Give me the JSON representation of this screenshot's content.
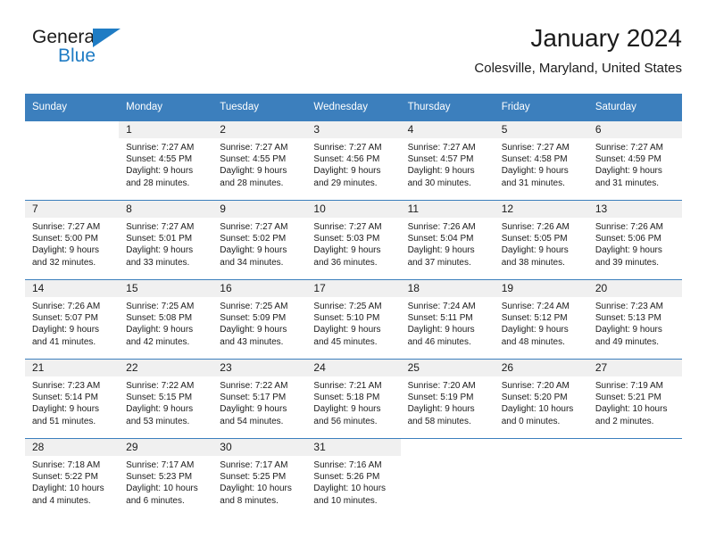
{
  "brand": {
    "name_part1": "General",
    "name_part2": "Blue",
    "accent_color": "#1f7cc4"
  },
  "header": {
    "title": "January 2024",
    "subtitle": "Colesville, Maryland, United States"
  },
  "calendar": {
    "header_bg": "#3c7fbd",
    "daynum_bg": "#f0f0f0",
    "weekday_headers": [
      "Sunday",
      "Monday",
      "Tuesday",
      "Wednesday",
      "Thursday",
      "Friday",
      "Saturday"
    ],
    "weeks": [
      [
        {
          "day": "",
          "sunrise": "",
          "sunset": "",
          "daylight1": "",
          "daylight2": ""
        },
        {
          "day": "1",
          "sunrise": "Sunrise: 7:27 AM",
          "sunset": "Sunset: 4:55 PM",
          "daylight1": "Daylight: 9 hours",
          "daylight2": "and 28 minutes."
        },
        {
          "day": "2",
          "sunrise": "Sunrise: 7:27 AM",
          "sunset": "Sunset: 4:55 PM",
          "daylight1": "Daylight: 9 hours",
          "daylight2": "and 28 minutes."
        },
        {
          "day": "3",
          "sunrise": "Sunrise: 7:27 AM",
          "sunset": "Sunset: 4:56 PM",
          "daylight1": "Daylight: 9 hours",
          "daylight2": "and 29 minutes."
        },
        {
          "day": "4",
          "sunrise": "Sunrise: 7:27 AM",
          "sunset": "Sunset: 4:57 PM",
          "daylight1": "Daylight: 9 hours",
          "daylight2": "and 30 minutes."
        },
        {
          "day": "5",
          "sunrise": "Sunrise: 7:27 AM",
          "sunset": "Sunset: 4:58 PM",
          "daylight1": "Daylight: 9 hours",
          "daylight2": "and 31 minutes."
        },
        {
          "day": "6",
          "sunrise": "Sunrise: 7:27 AM",
          "sunset": "Sunset: 4:59 PM",
          "daylight1": "Daylight: 9 hours",
          "daylight2": "and 31 minutes."
        }
      ],
      [
        {
          "day": "7",
          "sunrise": "Sunrise: 7:27 AM",
          "sunset": "Sunset: 5:00 PM",
          "daylight1": "Daylight: 9 hours",
          "daylight2": "and 32 minutes."
        },
        {
          "day": "8",
          "sunrise": "Sunrise: 7:27 AM",
          "sunset": "Sunset: 5:01 PM",
          "daylight1": "Daylight: 9 hours",
          "daylight2": "and 33 minutes."
        },
        {
          "day": "9",
          "sunrise": "Sunrise: 7:27 AM",
          "sunset": "Sunset: 5:02 PM",
          "daylight1": "Daylight: 9 hours",
          "daylight2": "and 34 minutes."
        },
        {
          "day": "10",
          "sunrise": "Sunrise: 7:27 AM",
          "sunset": "Sunset: 5:03 PM",
          "daylight1": "Daylight: 9 hours",
          "daylight2": "and 36 minutes."
        },
        {
          "day": "11",
          "sunrise": "Sunrise: 7:26 AM",
          "sunset": "Sunset: 5:04 PM",
          "daylight1": "Daylight: 9 hours",
          "daylight2": "and 37 minutes."
        },
        {
          "day": "12",
          "sunrise": "Sunrise: 7:26 AM",
          "sunset": "Sunset: 5:05 PM",
          "daylight1": "Daylight: 9 hours",
          "daylight2": "and 38 minutes."
        },
        {
          "day": "13",
          "sunrise": "Sunrise: 7:26 AM",
          "sunset": "Sunset: 5:06 PM",
          "daylight1": "Daylight: 9 hours",
          "daylight2": "and 39 minutes."
        }
      ],
      [
        {
          "day": "14",
          "sunrise": "Sunrise: 7:26 AM",
          "sunset": "Sunset: 5:07 PM",
          "daylight1": "Daylight: 9 hours",
          "daylight2": "and 41 minutes."
        },
        {
          "day": "15",
          "sunrise": "Sunrise: 7:25 AM",
          "sunset": "Sunset: 5:08 PM",
          "daylight1": "Daylight: 9 hours",
          "daylight2": "and 42 minutes."
        },
        {
          "day": "16",
          "sunrise": "Sunrise: 7:25 AM",
          "sunset": "Sunset: 5:09 PM",
          "daylight1": "Daylight: 9 hours",
          "daylight2": "and 43 minutes."
        },
        {
          "day": "17",
          "sunrise": "Sunrise: 7:25 AM",
          "sunset": "Sunset: 5:10 PM",
          "daylight1": "Daylight: 9 hours",
          "daylight2": "and 45 minutes."
        },
        {
          "day": "18",
          "sunrise": "Sunrise: 7:24 AM",
          "sunset": "Sunset: 5:11 PM",
          "daylight1": "Daylight: 9 hours",
          "daylight2": "and 46 minutes."
        },
        {
          "day": "19",
          "sunrise": "Sunrise: 7:24 AM",
          "sunset": "Sunset: 5:12 PM",
          "daylight1": "Daylight: 9 hours",
          "daylight2": "and 48 minutes."
        },
        {
          "day": "20",
          "sunrise": "Sunrise: 7:23 AM",
          "sunset": "Sunset: 5:13 PM",
          "daylight1": "Daylight: 9 hours",
          "daylight2": "and 49 minutes."
        }
      ],
      [
        {
          "day": "21",
          "sunrise": "Sunrise: 7:23 AM",
          "sunset": "Sunset: 5:14 PM",
          "daylight1": "Daylight: 9 hours",
          "daylight2": "and 51 minutes."
        },
        {
          "day": "22",
          "sunrise": "Sunrise: 7:22 AM",
          "sunset": "Sunset: 5:15 PM",
          "daylight1": "Daylight: 9 hours",
          "daylight2": "and 53 minutes."
        },
        {
          "day": "23",
          "sunrise": "Sunrise: 7:22 AM",
          "sunset": "Sunset: 5:17 PM",
          "daylight1": "Daylight: 9 hours",
          "daylight2": "and 54 minutes."
        },
        {
          "day": "24",
          "sunrise": "Sunrise: 7:21 AM",
          "sunset": "Sunset: 5:18 PM",
          "daylight1": "Daylight: 9 hours",
          "daylight2": "and 56 minutes."
        },
        {
          "day": "25",
          "sunrise": "Sunrise: 7:20 AM",
          "sunset": "Sunset: 5:19 PM",
          "daylight1": "Daylight: 9 hours",
          "daylight2": "and 58 minutes."
        },
        {
          "day": "26",
          "sunrise": "Sunrise: 7:20 AM",
          "sunset": "Sunset: 5:20 PM",
          "daylight1": "Daylight: 10 hours",
          "daylight2": "and 0 minutes."
        },
        {
          "day": "27",
          "sunrise": "Sunrise: 7:19 AM",
          "sunset": "Sunset: 5:21 PM",
          "daylight1": "Daylight: 10 hours",
          "daylight2": "and 2 minutes."
        }
      ],
      [
        {
          "day": "28",
          "sunrise": "Sunrise: 7:18 AM",
          "sunset": "Sunset: 5:22 PM",
          "daylight1": "Daylight: 10 hours",
          "daylight2": "and 4 minutes."
        },
        {
          "day": "29",
          "sunrise": "Sunrise: 7:17 AM",
          "sunset": "Sunset: 5:23 PM",
          "daylight1": "Daylight: 10 hours",
          "daylight2": "and 6 minutes."
        },
        {
          "day": "30",
          "sunrise": "Sunrise: 7:17 AM",
          "sunset": "Sunset: 5:25 PM",
          "daylight1": "Daylight: 10 hours",
          "daylight2": "and 8 minutes."
        },
        {
          "day": "31",
          "sunrise": "Sunrise: 7:16 AM",
          "sunset": "Sunset: 5:26 PM",
          "daylight1": "Daylight: 10 hours",
          "daylight2": "and 10 minutes."
        },
        {
          "day": "",
          "sunrise": "",
          "sunset": "",
          "daylight1": "",
          "daylight2": ""
        },
        {
          "day": "",
          "sunrise": "",
          "sunset": "",
          "daylight1": "",
          "daylight2": ""
        },
        {
          "day": "",
          "sunrise": "",
          "sunset": "",
          "daylight1": "",
          "daylight2": ""
        }
      ]
    ]
  }
}
